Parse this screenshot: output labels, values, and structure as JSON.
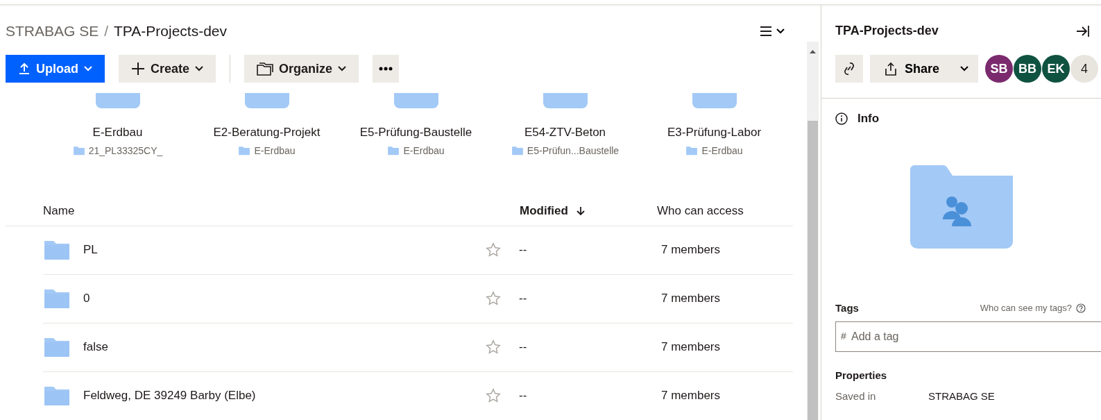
{
  "breadcrumb": {
    "parent": "STRABAG SE",
    "separator": "/",
    "current": "TPA-Projects-dev"
  },
  "toolbar": {
    "buttons": [
      {
        "kind": "primary",
        "label": "Upload"
      },
      {
        "kind": "create",
        "label": "Create"
      },
      {
        "kind": "organize",
        "label": "Organize"
      },
      {
        "kind": "more"
      }
    ]
  },
  "suggested": [
    {
      "name": "E-Erdbau",
      "location": "21_PL33325CY_"
    },
    {
      "name": "E2-Beratung-Projekt",
      "location": "E-Erdbau"
    },
    {
      "name": "E5-Prüfung-Baustelle",
      "location": "E-Erdbau"
    },
    {
      "name": "E54-ZTV-Beton",
      "location": "E5-Prüfun...Baustelle"
    },
    {
      "name": "E3-Prüfung-Labor",
      "location": "E-Erdbau"
    }
  ],
  "table": {
    "columns": [
      {
        "label": "Name",
        "sorted": false
      },
      {
        "label": "Modified",
        "sorted": true
      },
      {
        "label": "Who can access",
        "sorted": false
      }
    ],
    "rows": [
      {
        "name": "PL",
        "starred": false,
        "modified": "--",
        "access": "7 members"
      },
      {
        "name": "0",
        "starred": false,
        "modified": "--",
        "access": "7 members"
      },
      {
        "name": "false",
        "starred": false,
        "modified": "--",
        "access": "7 members"
      },
      {
        "name": "Feldweg, DE 39249 Barby (Elbe)",
        "starred": false,
        "modified": "--",
        "access": "7 members"
      }
    ]
  },
  "panel": {
    "title": "TPA-Projects-dev",
    "share_label": "Share",
    "members": [
      {
        "initials": "SB",
        "color": "#7b2a6e"
      },
      {
        "initials": "BB",
        "color": "#0f5240"
      },
      {
        "initials": "EK",
        "color": "#0f5240"
      },
      {
        "initials": "4",
        "color": "#e8e4de"
      }
    ],
    "info_label": "Info",
    "tags_label": "Tags",
    "tags_help": "Who can see my tags?",
    "tag_placeholder": "Add a tag",
    "tag_prefix": "#",
    "properties_label": "Properties",
    "properties": [
      {
        "label": "Saved in",
        "value": "STRABAG SE"
      }
    ]
  }
}
